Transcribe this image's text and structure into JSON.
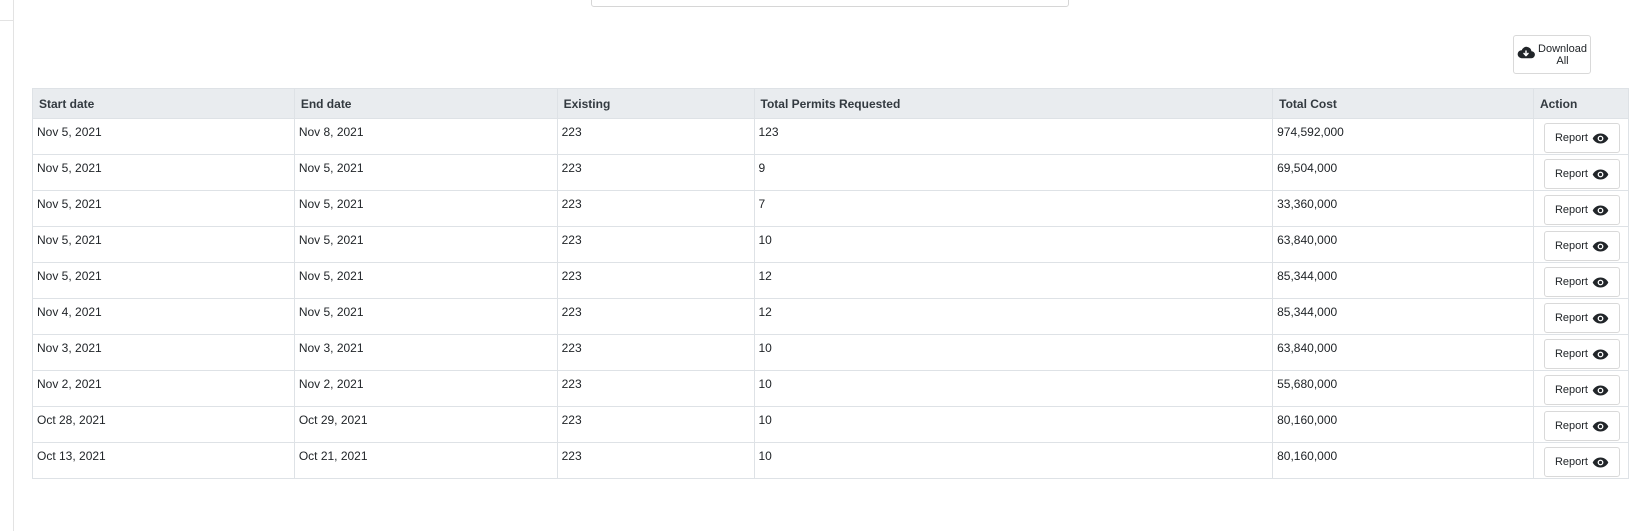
{
  "toolbar": {
    "download_all_label": "Download All"
  },
  "table": {
    "headers": {
      "start_date": "Start date",
      "end_date": "End date",
      "existing": "Existing",
      "total_permits": "Total Permits Requested",
      "total_cost": "Total Cost",
      "action": "Action"
    },
    "rows": [
      {
        "start_date": "Nov 5, 2021",
        "end_date": "Nov 8, 2021",
        "existing": "223",
        "total_permits": "123",
        "total_cost": "974,592,000",
        "action_label": "Report"
      },
      {
        "start_date": "Nov 5, 2021",
        "end_date": "Nov 5, 2021",
        "existing": "223",
        "total_permits": "9",
        "total_cost": "69,504,000",
        "action_label": "Report"
      },
      {
        "start_date": "Nov 5, 2021",
        "end_date": "Nov 5, 2021",
        "existing": "223",
        "total_permits": "7",
        "total_cost": "33,360,000",
        "action_label": "Report"
      },
      {
        "start_date": "Nov 5, 2021",
        "end_date": "Nov 5, 2021",
        "existing": "223",
        "total_permits": "10",
        "total_cost": "63,840,000",
        "action_label": "Report"
      },
      {
        "start_date": "Nov 5, 2021",
        "end_date": "Nov 5, 2021",
        "existing": "223",
        "total_permits": "12",
        "total_cost": "85,344,000",
        "action_label": "Report"
      },
      {
        "start_date": "Nov 4, 2021",
        "end_date": "Nov 5, 2021",
        "existing": "223",
        "total_permits": "12",
        "total_cost": "85,344,000",
        "action_label": "Report"
      },
      {
        "start_date": "Nov 3, 2021",
        "end_date": "Nov 3, 2021",
        "existing": "223",
        "total_permits": "10",
        "total_cost": "63,840,000",
        "action_label": "Report"
      },
      {
        "start_date": "Nov 2, 2021",
        "end_date": "Nov 2, 2021",
        "existing": "223",
        "total_permits": "10",
        "total_cost": "55,680,000",
        "action_label": "Report"
      },
      {
        "start_date": "Oct 28, 2021",
        "end_date": "Oct 29, 2021",
        "existing": "223",
        "total_permits": "10",
        "total_cost": "80,160,000",
        "action_label": "Report"
      },
      {
        "start_date": "Oct 13, 2021",
        "end_date": "Oct 21, 2021",
        "existing": "223",
        "total_permits": "10",
        "total_cost": "80,160,000",
        "action_label": "Report"
      }
    ]
  },
  "icons": {
    "download": "cloud-download-icon",
    "report": "eye-icon"
  },
  "colors": {
    "header_bg": "#e9ecef",
    "border": "#dee2e6",
    "text": "#212529"
  }
}
